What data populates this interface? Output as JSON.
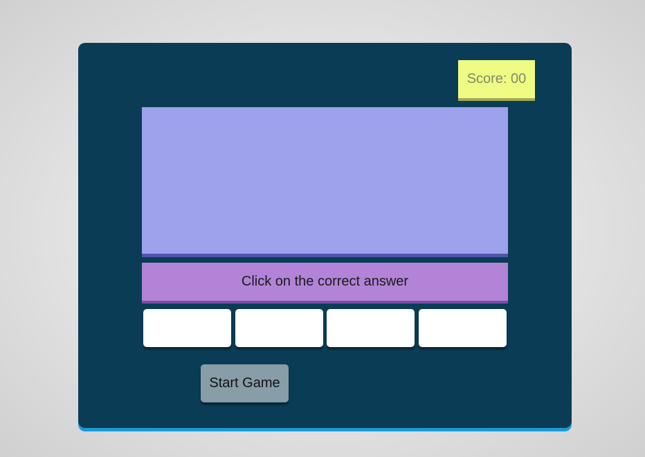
{
  "score": {
    "label": "Score: 00"
  },
  "question": {
    "text": ""
  },
  "instruction": {
    "text": "Click on the correct answer"
  },
  "choices": [
    {
      "label": ""
    },
    {
      "label": ""
    },
    {
      "label": ""
    },
    {
      "label": ""
    }
  ],
  "controls": {
    "start_label": "Start Game"
  },
  "colors": {
    "panel": "#0a3d55",
    "panel_accent": "#1a9ad6",
    "score_bg": "#eefc84",
    "question_bg": "#9ea1eb",
    "instruction_bg": "#b283d7",
    "choice_bg": "#ffffff",
    "start_button_bg": "#879da7"
  }
}
